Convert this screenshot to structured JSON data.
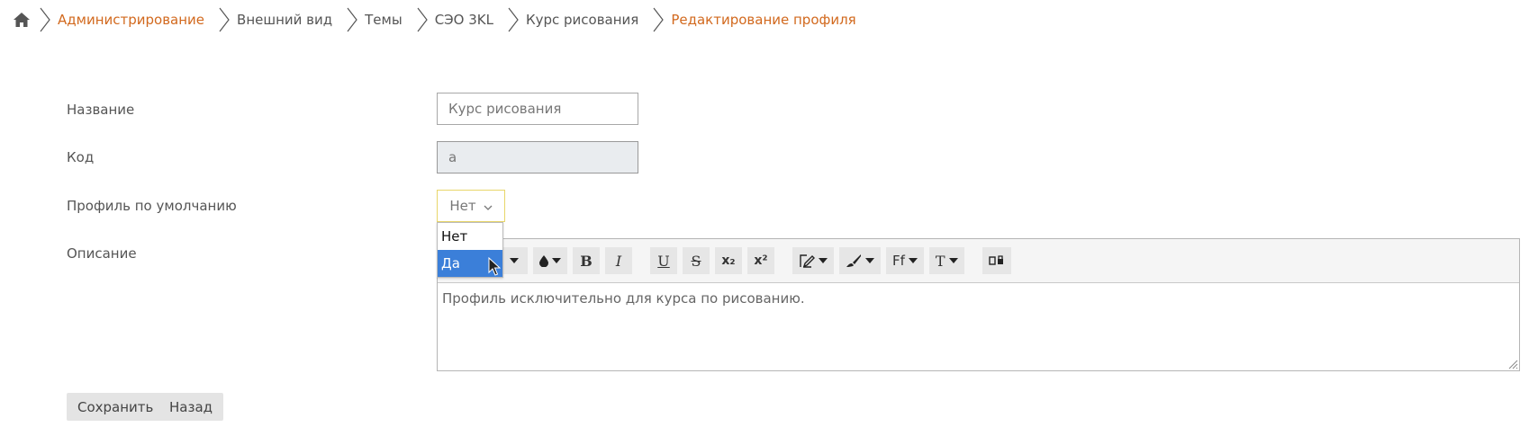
{
  "breadcrumb": {
    "items": [
      {
        "label": "Администрирование",
        "link": true
      },
      {
        "label": "Внешний вид",
        "link": false
      },
      {
        "label": "Темы",
        "link": false
      },
      {
        "label": "СЭО 3KL",
        "link": false
      },
      {
        "label": "Курс рисования",
        "link": false
      },
      {
        "label": "Редактирование профиля",
        "link": true
      }
    ]
  },
  "form": {
    "name_label": "Название",
    "name_value": "Курс рисования",
    "code_label": "Код",
    "code_value": "a",
    "default_label": "Профиль по умолчанию",
    "default_value": "Нет",
    "default_options": [
      "Нет",
      "Да"
    ],
    "description_label": "Описание",
    "description_text": "Профиль исключительно для курса по рисованию."
  },
  "toolbar": {
    "bold": "B",
    "italic": "I",
    "underline": "U",
    "strike": "S",
    "subscript": "x₂",
    "superscript": "x²",
    "font_family": "Ff",
    "font_size": "T"
  },
  "buttons": {
    "save": "Сохранить",
    "back": "Назад"
  },
  "colors": {
    "link": "#d2691e",
    "selected_option": "#3b7fd9",
    "select_border": "#e8d66a"
  }
}
